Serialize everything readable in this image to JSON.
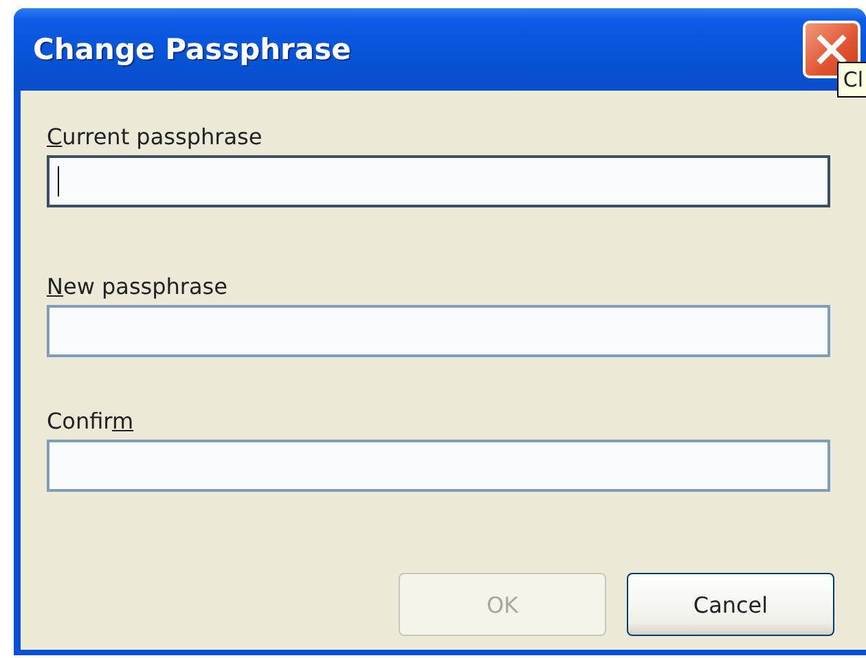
{
  "window": {
    "title": "Change Passphrase"
  },
  "tooltip": {
    "text": "Cl"
  },
  "fields": [
    {
      "label": [
        {
          "text": "C",
          "access_key": true
        },
        {
          "text": "urrent passphrase",
          "access_key": false
        }
      ],
      "focused": true
    },
    {
      "label": [
        {
          "text": "N",
          "access_key": true
        },
        {
          "text": "ew passphrase",
          "access_key": false
        }
      ],
      "focused": false
    },
    {
      "label": [
        {
          "text": "Confir",
          "access_key": false
        },
        {
          "text": "m",
          "access_key": true
        }
      ],
      "focused": false
    }
  ],
  "buttons": [
    {
      "label": "OK",
      "disabled": true
    },
    {
      "label": "Cancel",
      "disabled": false
    }
  ]
}
